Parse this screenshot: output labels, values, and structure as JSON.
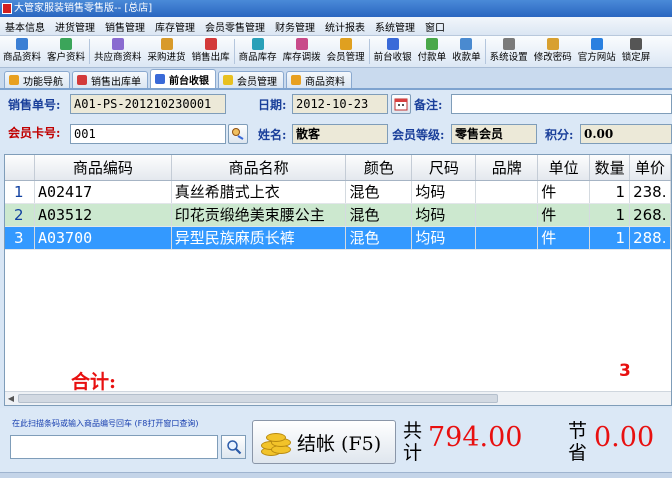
{
  "window": {
    "title": "大管家服装销售零售版-- [总店]"
  },
  "menu": [
    "基本信息",
    "进货管理",
    "销售管理",
    "库存管理",
    "会员零售管理",
    "财务管理",
    "统计报表",
    "系统管理",
    "窗口"
  ],
  "toolbar": [
    {
      "label": "商品资料",
      "color": "#3b7fd4"
    },
    {
      "label": "客户资料",
      "color": "#3ba55a"
    },
    {
      "label": "共应商资料",
      "color": "#8a6bd0"
    },
    {
      "label": "采购进货",
      "color": "#d89a2a"
    },
    {
      "label": "销售出库",
      "color": "#d33a3a"
    },
    {
      "label": "商品库存",
      "color": "#2aa0b8"
    },
    {
      "label": "库存调拨",
      "color": "#c84a8a"
    },
    {
      "label": "会员管理",
      "color": "#e0a020"
    },
    {
      "label": "前台收银",
      "color": "#3a6ad8"
    },
    {
      "label": "付款单",
      "color": "#4aa84a"
    },
    {
      "label": "收款单",
      "color": "#4a8ad0"
    },
    {
      "label": "系统设置",
      "color": "#7a7a7a"
    },
    {
      "label": "修改密码",
      "color": "#d8a030"
    },
    {
      "label": "官方网站",
      "color": "#2a80e0"
    },
    {
      "label": "锁定屏",
      "color": "#555555"
    }
  ],
  "tabs": [
    {
      "label": "功能导航",
      "color": "#e8a020"
    },
    {
      "label": "销售出库单",
      "color": "#d33a3a"
    },
    {
      "label": "前台收银",
      "color": "#3a6ad8"
    },
    {
      "label": "会员管理",
      "color": "#e8c020"
    },
    {
      "label": "商品资料",
      "color": "#e8a020"
    }
  ],
  "form": {
    "order_no_label": "销售单号:",
    "order_no": "A01-PS-201210230001",
    "date_label": "日期:",
    "date": "2012-10-23",
    "note_label": "备注:",
    "note": "",
    "card_label": "会员卡号:",
    "card_no": "001",
    "name_label": "姓名:",
    "name": "散客",
    "level_label": "会员等级:",
    "level": "零售会员",
    "points_label": "积分:",
    "points": "0.00"
  },
  "grid": {
    "columns": [
      "商品编码",
      "商品名称",
      "颜色",
      "尺码",
      "品牌",
      "单位",
      "数量",
      "单价"
    ],
    "rows": [
      {
        "idx": "1",
        "code": "A02417",
        "name": "真丝希腊式上衣",
        "color": "混色",
        "size": "均码",
        "brand": "",
        "unit": "件",
        "qty": "1",
        "price": "238."
      },
      {
        "idx": "2",
        "code": "A03512",
        "name": "印花贡缎绝美束腰公主",
        "color": "混色",
        "size": "均码",
        "brand": "",
        "unit": "件",
        "qty": "1",
        "price": "268."
      },
      {
        "idx": "3",
        "code": "A03700",
        "name": "异型民族麻质长裤",
        "color": "混色",
        "size": "均码",
        "brand": "",
        "unit": "件",
        "qty": "1",
        "price": "288."
      }
    ],
    "sum_label": "合计:",
    "sum_qty": "3"
  },
  "bottom": {
    "scan_hint": "在此扫描条码或输入商品编号回车 (F8打开窗口查询)",
    "scan_value": "",
    "checkout_label": "结帐 (F5)",
    "total_caption": "共计",
    "total_value": "794.00",
    "save_caption": "节省",
    "save_value": "0.00"
  }
}
